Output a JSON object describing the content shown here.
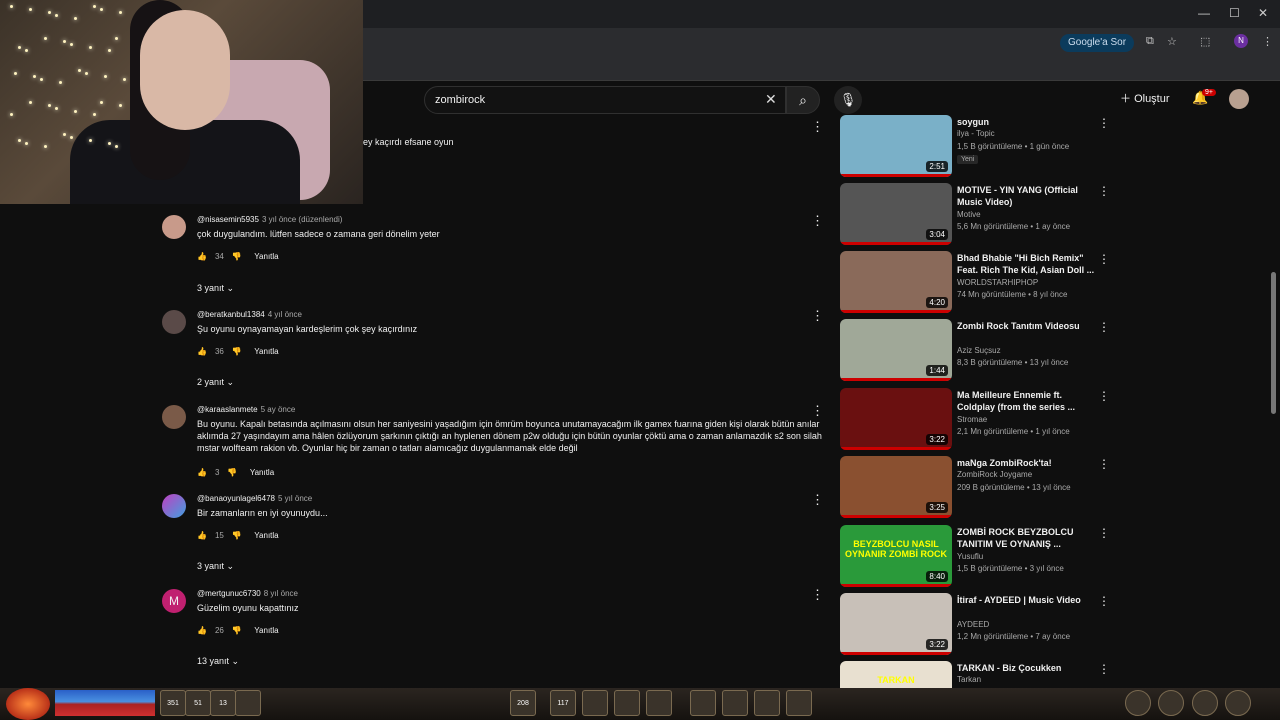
{
  "browser": {
    "window_controls": [
      "—",
      "☐",
      "✕"
    ],
    "google_ask": "Google'a Sor",
    "profile_initial": "N"
  },
  "header": {
    "search_value": "zombirock",
    "create_label": "Oluştur",
    "notif_count": "9+"
  },
  "comments_top": {
    "partial_text": "ey kaçırdı efsane oyun"
  },
  "comments": [
    {
      "author": "@nisasemin5935",
      "time": "3 yıl önce (düzenlendi)",
      "text": "çok duygulandım. lütfen sadece o  zamana geri dönelim yeter",
      "likes": "34",
      "reply": "Yanıtla",
      "replies": "3 yanıt"
    },
    {
      "author": "@beratkanbul1384",
      "time": "4 yıl önce",
      "text": "Şu oyunu oynayamayan kardeşlerim çok şey kaçırdınız",
      "likes": "36",
      "reply": "Yanıtla",
      "replies": "2 yanıt"
    },
    {
      "author": "@karaaslanmete",
      "time": "5 ay önce",
      "text": "Bu oyunu. Kapalı betasında açılmasını olsun her saniyesini yaşadığım için ömrüm boyunca unutamayacağım ilk gamex fuarına giden kişi olarak bütün anılar aklımda 27 yaşındayım ama hâlen özlüyorum şarkının çıktığı an hyplenen dönem p2w olduğu için bütün oyunlar çöktü ama o zaman anlamazdık s2 son silah mstar wolfteam rakion vb. Oyunlar hiç bir zaman o tatları alamıcağız duygulanmamak elde değil",
      "likes": "3",
      "reply": "Yanıtla",
      "replies": ""
    },
    {
      "author": "@banaoyunlagel6478",
      "time": "5 yıl önce",
      "text": "Bir zamanların en iyi oyunuydu...",
      "likes": "15",
      "reply": "Yanıtla",
      "replies": "3 yanıt"
    },
    {
      "author": "@mertgunuc6730",
      "time": "8 yıl önce",
      "text": "Güzelim oyunu kapattınız",
      "likes": "26",
      "reply": "Yanıtla",
      "replies": "13 yanıt"
    }
  ],
  "videos": [
    {
      "title": "soygun",
      "channel": "ilya - Topic",
      "meta": "1,5 B görüntüleme • 1 gün önce",
      "duration": "2:51",
      "badge": "Yeni",
      "color": "#7ab0c8"
    },
    {
      "title": "MOTIVE - YIN YANG (Official Music Video)",
      "channel": "Motive",
      "meta": "5,6 Mn görüntüleme • 1 ay önce",
      "duration": "3:04",
      "badge": "",
      "color": "#555"
    },
    {
      "title": "Bhad Bhabie \"Hi Bich Remix\" Feat. Rich The Kid, Asian Doll ...",
      "channel": "WORLDSTARHIPHOP",
      "meta": "74 Mn görüntüleme • 8 yıl önce",
      "duration": "4:20",
      "badge": "",
      "color": "#8a6a5a"
    },
    {
      "title": "Zombi Rock Tanıtım Videosu",
      "channel": "Aziz Suçsuz",
      "meta": "8,3 B görüntüleme • 13 yıl önce",
      "duration": "1:44",
      "badge": "",
      "color": "#a0a898"
    },
    {
      "title": "Ma Meilleure Ennemie ft. Coldplay (from the series ...",
      "channel": "Stromae",
      "meta": "2,1 Mn görüntüleme • 1 yıl önce",
      "duration": "3:22",
      "badge": "",
      "color": "#6a1010"
    },
    {
      "title": "maNga ZombiRock'ta!",
      "channel": "ZombiRock Joygame",
      "meta": "209 B görüntüleme • 13 yıl önce",
      "duration": "3:25",
      "badge": "",
      "color": "#8a5030"
    },
    {
      "title": "ZOMBİ ROCK BEYZBOLCU TANITIM VE OYNANIŞ ...",
      "channel": "Yusuflu",
      "meta": "1,5 B görüntüleme • 3 yıl önce",
      "duration": "8:40",
      "badge": "",
      "color": "#2a9a3a",
      "thumb_text": "BEYZBOLCU NASIL OYNANIR ZOMBİ ROCK"
    },
    {
      "title": "İtiraf - AYDEED | Music Video",
      "channel": "AYDEED",
      "meta": "1,2 Mn görüntüleme • 7 ay önce",
      "duration": "3:22",
      "badge": "",
      "color": "#c8c0b8"
    },
    {
      "title": "TARKAN - Biz Çocukken",
      "channel": "Tarkan",
      "meta": "",
      "duration": "",
      "badge": "",
      "color": "#e8e0d0",
      "thumb_text": "TARKAN"
    }
  ],
  "hud": {
    "slots": [
      "351",
      "51",
      "13",
      "",
      "208",
      "117",
      "",
      "",
      "",
      "",
      "",
      "",
      ""
    ]
  }
}
